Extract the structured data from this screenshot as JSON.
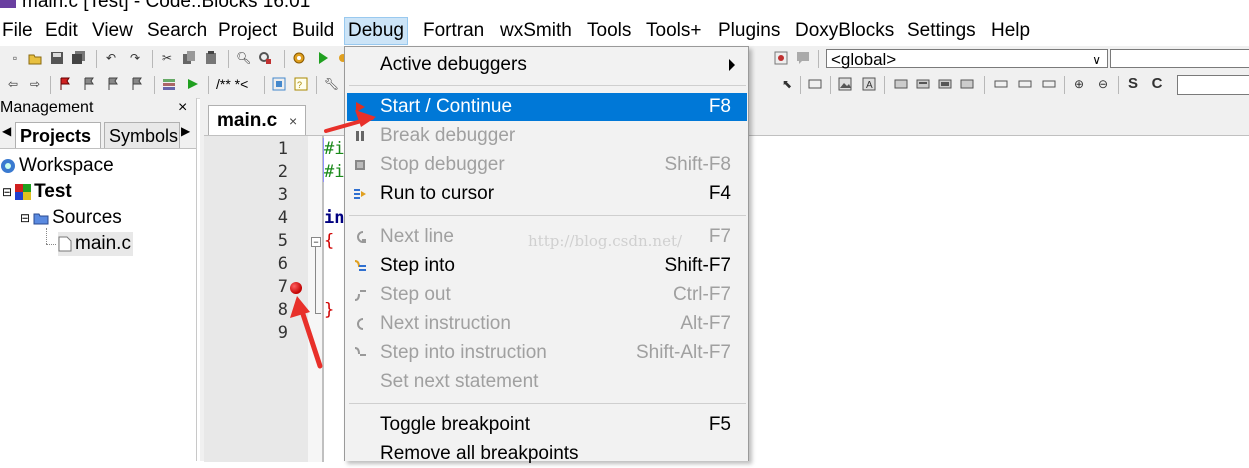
{
  "window": {
    "title": "main.c [Test] - Code::Blocks 16.01"
  },
  "menubar": {
    "items": [
      "File",
      "Edit",
      "View",
      "Search",
      "Project",
      "Build",
      "Debug",
      "Fortran",
      "wxSmith",
      "Tools",
      "Tools+",
      "Plugins",
      "DoxyBlocks",
      "Settings",
      "Help"
    ],
    "active": "Debug"
  },
  "toolbar": {
    "scope_combo": "<global>",
    "comment_text": "/** *<",
    "text_s": "S",
    "text_c": "C"
  },
  "management": {
    "title": "Management",
    "close": "×",
    "tabs": [
      "Projects",
      "Symbols"
    ],
    "tree": {
      "workspace": "Workspace",
      "project": "Test",
      "folder": "Sources",
      "file": "main.c"
    }
  },
  "editor": {
    "tab_label": "main.c",
    "tab_close": "×",
    "line_numbers": [
      "1",
      "2",
      "3",
      "4",
      "5",
      "6",
      "7",
      "8",
      "9"
    ],
    "code_fragments": {
      "l1": "#i",
      "l2": "#i",
      "l4": "in",
      "l5": "{",
      "l8": "}"
    },
    "breakpoint_line": 7
  },
  "debug_menu": {
    "items": [
      {
        "label": "Active debuggers",
        "shortcut": "",
        "state": "normal",
        "submenu": true
      },
      {
        "label": "Start / Continue",
        "shortcut": "F8",
        "state": "highlighted"
      },
      {
        "label": "Break debugger",
        "shortcut": "",
        "state": "disabled"
      },
      {
        "label": "Stop debugger",
        "shortcut": "Shift-F8",
        "state": "disabled"
      },
      {
        "label": "Run to cursor",
        "shortcut": "F4",
        "state": "normal"
      },
      {
        "label": "Next line",
        "shortcut": "F7",
        "state": "disabled"
      },
      {
        "label": "Step into",
        "shortcut": "Shift-F7",
        "state": "normal"
      },
      {
        "label": "Step out",
        "shortcut": "Ctrl-F7",
        "state": "disabled"
      },
      {
        "label": "Next instruction",
        "shortcut": "Alt-F7",
        "state": "disabled"
      },
      {
        "label": "Step into instruction",
        "shortcut": "Shift-Alt-F7",
        "state": "disabled"
      },
      {
        "label": "Set next statement",
        "shortcut": "",
        "state": "disabled"
      },
      {
        "label": "Toggle breakpoint",
        "shortcut": "F5",
        "state": "normal"
      },
      {
        "label": "Remove all breakpoints",
        "shortcut": "",
        "state": "normal"
      }
    ]
  },
  "watermark": "http://blog.csdn.net/",
  "colors": {
    "highlight": "#0078d7",
    "breakpoint": "#d00000",
    "annotation": "#e8302a"
  }
}
